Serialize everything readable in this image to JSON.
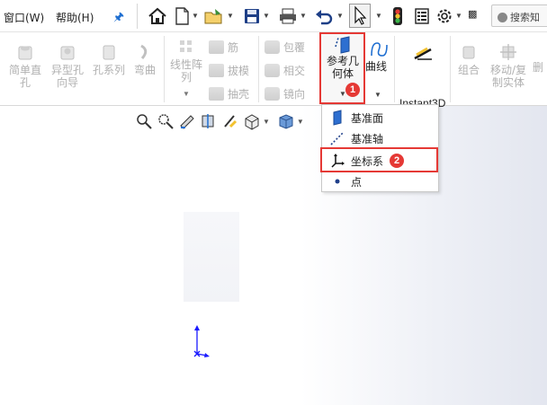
{
  "menu": {
    "window_label": "窗口(W)",
    "help_label": "帮助(H)"
  },
  "search": {
    "placeholder": "搜索知",
    "icon": "search-icon"
  },
  "ribbon": {
    "simple_hole": "简单直孔",
    "wizard_hole": "异型孔向导",
    "hole_series": "孔系列",
    "bend": "弯曲",
    "linear_pattern": "线性阵列",
    "rib": "筋",
    "draft": "拔模",
    "shell": "抽壳",
    "wrap": "包覆",
    "intersect": "相交",
    "mirror": "镜向",
    "reference_geometry": "参考几何体",
    "curves": "曲线",
    "instant3d": "Instant3D",
    "combine": "组合",
    "move_copy_body": "移动/复制实体",
    "delete_body_partial": "删"
  },
  "badges": {
    "step1": "1",
    "step2": "2"
  },
  "dropdown": {
    "items": [
      {
        "label": "基准面",
        "icon": "plane-icon"
      },
      {
        "label": "基准轴",
        "icon": "axis-icon"
      },
      {
        "label": "坐标系",
        "icon": "coordinate-system-icon"
      },
      {
        "label": "点",
        "icon": "point-icon"
      }
    ]
  },
  "colors": {
    "highlight_red": "#e53935",
    "triad_blue": "#1a1aff",
    "accent_blue": "#1f6fd1"
  }
}
